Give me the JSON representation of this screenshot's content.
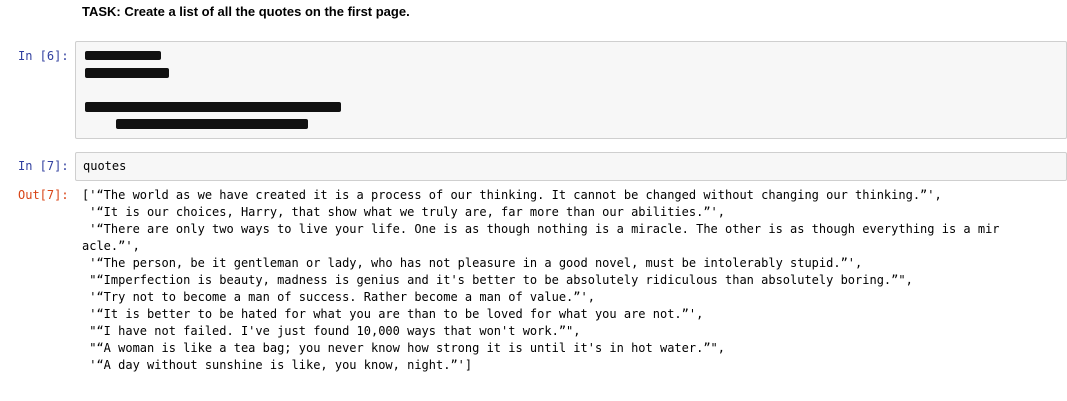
{
  "task": {
    "text": "TASK: Create a list of all the quotes on the first page."
  },
  "cells": [
    {
      "prompt": "In [6]:",
      "redacted": true
    },
    {
      "prompt": "In [7]:",
      "code": "quotes"
    }
  ],
  "output": {
    "prompt": "Out[7]:",
    "lines": [
      "['“The world as we have created it is a process of our thinking. It cannot be changed without changing our thinking.”',",
      " '“It is our choices, Harry, that show what we truly are, far more than our abilities.”',",
      " '“There are only two ways to live your life. One is as though nothing is a miracle. The other is as though everything is a mir",
      "acle.”',",
      " '“The person, be it gentleman or lady, who has not pleasure in a good novel, must be intolerably stupid.”',",
      " \"“Imperfection is beauty, madness is genius and it's better to be absolutely ridiculous than absolutely boring.”\",",
      " '“Try not to become a man of success. Rather become a man of value.”',",
      " '“It is better to be hated for what you are than to be loved for what you are not.”',",
      " \"“I have not failed. I've just found 10,000 ways that won't work.”\",",
      " \"“A woman is like a tea bag; you never know how strong it is until it's in hot water.”\",",
      " '“A day without sunshine is like, you know, night.”']"
    ]
  }
}
